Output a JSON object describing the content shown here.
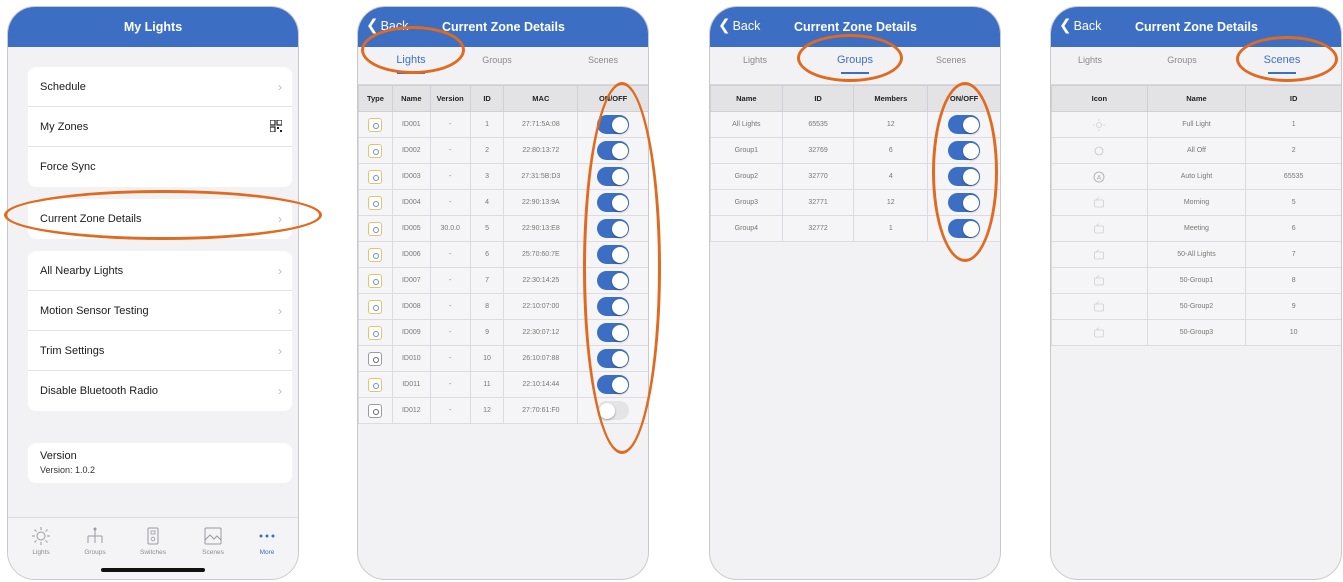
{
  "accent_color": "#3c6fc4",
  "annotation_color": "#e06a1f",
  "screen1": {
    "title": "My Lights",
    "menu": [
      "Schedule",
      "My Zones",
      "Force Sync",
      "Current Zone Details",
      "All Nearby Lights",
      "Motion Sensor Testing",
      "Trim Settings",
      "Disable Bluetooth Radio"
    ],
    "version_title": "Version",
    "version_value": "Version: 1.0.2",
    "tabs": [
      {
        "label": "Lights",
        "icon": "sun-icon"
      },
      {
        "label": "Groups",
        "icon": "hierarchy-icon"
      },
      {
        "label": "Switches",
        "icon": "switch-icon"
      },
      {
        "label": "Scenes",
        "icon": "image-icon"
      },
      {
        "label": "More",
        "icon": "more-dots-icon"
      }
    ],
    "active_tab": "More"
  },
  "detail": {
    "back": "Back",
    "title": "Current Zone Details",
    "tabs": [
      "Lights",
      "Groups",
      "Scenes"
    ]
  },
  "lights_table": {
    "headers": [
      "Type",
      "Name",
      "Version",
      "ID",
      "MAC",
      "ON/OFF"
    ],
    "rows": [
      {
        "name": "ID001",
        "version": "-",
        "id": "1",
        "mac": "27:71:5A:08",
        "on": true
      },
      {
        "name": "ID002",
        "version": "-",
        "id": "2",
        "mac": "22:80:13:72",
        "on": true
      },
      {
        "name": "ID003",
        "version": "-",
        "id": "3",
        "mac": "27:31:5B:D3",
        "on": true
      },
      {
        "name": "ID004",
        "version": "-",
        "id": "4",
        "mac": "22:90:13:9A",
        "on": true
      },
      {
        "name": "ID005",
        "version": "30.0.0",
        "id": "5",
        "mac": "22:90:13:E8",
        "on": true
      },
      {
        "name": "ID006",
        "version": "-",
        "id": "6",
        "mac": "25:70:60:7E",
        "on": true
      },
      {
        "name": "ID007",
        "version": "-",
        "id": "7",
        "mac": "22:30:14:25",
        "on": true
      },
      {
        "name": "ID008",
        "version": "-",
        "id": "8",
        "mac": "22:10:07:00",
        "on": true
      },
      {
        "name": "ID009",
        "version": "-",
        "id": "9",
        "mac": "22:30:07:12",
        "on": true
      },
      {
        "name": "ID010",
        "version": "-",
        "id": "10",
        "mac": "26:10:07:88",
        "on": true
      },
      {
        "name": "ID011",
        "version": "-",
        "id": "11",
        "mac": "22:10:14:44",
        "on": true
      },
      {
        "name": "ID012",
        "version": "-",
        "id": "12",
        "mac": "27:70:61:F0",
        "on": false
      }
    ]
  },
  "groups_table": {
    "headers": [
      "Name",
      "ID",
      "Members",
      "ON/OFF"
    ],
    "rows": [
      {
        "name": "All Lights",
        "id": "65535",
        "members": "12",
        "on": true
      },
      {
        "name": "Group1",
        "id": "32769",
        "members": "6",
        "on": true
      },
      {
        "name": "Group2",
        "id": "32770",
        "members": "4",
        "on": true
      },
      {
        "name": "Group3",
        "id": "32771",
        "members": "12",
        "on": true
      },
      {
        "name": "Group4",
        "id": "32772",
        "members": "1",
        "on": true
      }
    ]
  },
  "scenes_table": {
    "headers": [
      "Icon",
      "Name",
      "ID"
    ],
    "rows": [
      {
        "name": "Full Light",
        "id": "1",
        "icon": "sun-icon"
      },
      {
        "name": "All Off",
        "id": "2",
        "icon": "circle-icon"
      },
      {
        "name": "Auto Light",
        "id": "65535",
        "icon": "auto-a-icon"
      },
      {
        "name": "Morning",
        "id": "5",
        "icon": "morning-icon"
      },
      {
        "name": "Meeting",
        "id": "6",
        "icon": "meeting-icon"
      },
      {
        "name": "50-All Lights",
        "id": "7",
        "icon": "scene-icon"
      },
      {
        "name": "50-Group1",
        "id": "8",
        "icon": "scene-icon"
      },
      {
        "name": "50-Group2",
        "id": "9",
        "icon": "scene-icon"
      },
      {
        "name": "50-Group3",
        "id": "10",
        "icon": "scene-icon"
      }
    ]
  }
}
